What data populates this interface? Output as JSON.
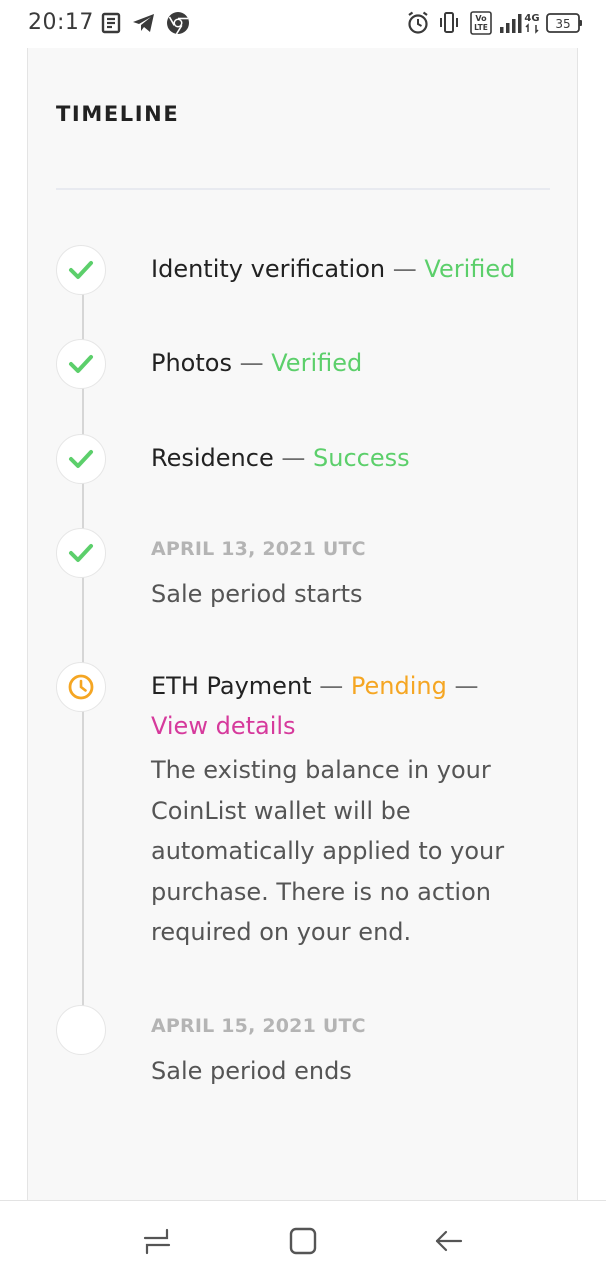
{
  "status_bar": {
    "time": "20:17",
    "battery": "35",
    "network": "4G",
    "volte": "Vo LTE",
    "left_icons": [
      "news-icon",
      "telegram-icon",
      "chrome-icon"
    ],
    "right_icons": [
      "alarm-icon",
      "vibrate-icon",
      "volte-icon",
      "signal-icon",
      "network-4g-icon",
      "battery-icon"
    ]
  },
  "timeline": {
    "title": "TIMELINE",
    "items": [
      {
        "icon": "check-icon",
        "label": "Identity verification",
        "separator": "—",
        "status": "Verified"
      },
      {
        "icon": "check-icon",
        "label": "Photos",
        "separator": "—",
        "status": "Verified"
      },
      {
        "icon": "check-icon",
        "label": "Residence",
        "separator": "—",
        "status": "Success"
      },
      {
        "icon": "check-icon",
        "date": "APRIL 13, 2021 UTC",
        "label": "Sale period starts"
      },
      {
        "icon": "clock-icon",
        "label": "ETH Payment",
        "separator": "—",
        "status": "Pending",
        "separator2": "—",
        "link": "View details",
        "description": "The existing balance in your CoinList wallet will be automatically applied to your purchase. There is no action required on your end."
      },
      {
        "icon": "empty-circle",
        "date": "APRIL 15, 2021 UTC",
        "label": "Sale period ends"
      }
    ]
  },
  "colors": {
    "success_green": "#5ccf6b",
    "pending_orange": "#f5a623",
    "link_pink": "#d63a9c",
    "card_background": "#f8f8f8"
  },
  "nav_bar": {
    "icons": [
      "recent-apps-icon",
      "home-icon",
      "back-icon"
    ]
  }
}
